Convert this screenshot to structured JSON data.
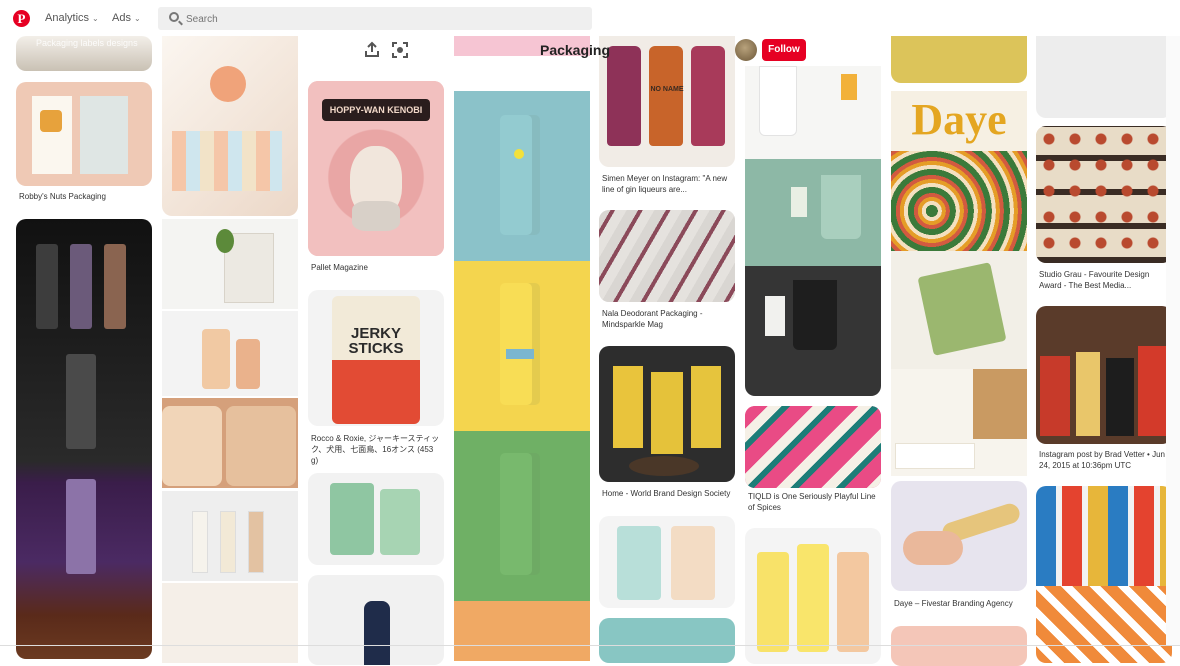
{
  "nav": {
    "logo": "P",
    "analytics": "Analytics",
    "ads": "Ads",
    "chevron": "⌄"
  },
  "search": {
    "placeholder": "Search"
  },
  "board": {
    "title": "Packaging",
    "follow_label": "Follow",
    "share_icon": "share-icon",
    "select_icon": "select-pins-icon"
  },
  "ghost_text": {
    "top_left": "Packaging labels designs"
  },
  "pins": [
    {
      "caption": "Robby's Nuts Packaging"
    },
    {
      "caption": "Pallet Magazine",
      "art_text": "HOPPY-WAN KENOBI"
    },
    {
      "caption": "Rocco & Roxie, ジャーキースティック、犬用、七面鳥、16オンス (453 g)",
      "art_text": "JERKY STICKS"
    },
    {
      "caption": "Simen Meyer on Instagram: \"A new line of gin liqueurs are...",
      "art_text": "NO NAME"
    },
    {
      "caption": "Nala Deodorant Packaging - Mindsparkle Mag"
    },
    {
      "caption": "Home - World Brand Design Society"
    },
    {
      "caption": "TIQLD is One Seriously Playful Line of Spices"
    },
    {
      "caption": "Daye – Fivestar Branding Agency",
      "art_text": "Daye"
    },
    {
      "caption": "Studio Grau - Favourite Design Award - The Best Media..."
    },
    {
      "caption": "Instagram post by Brad Vetter • Jun 24, 2015 at 10:36pm UTC"
    }
  ]
}
